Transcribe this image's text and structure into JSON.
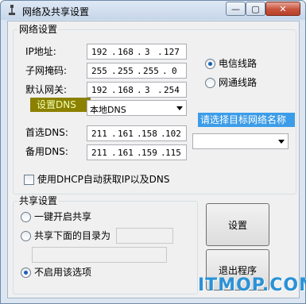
{
  "window": {
    "title": "网络及共享设置",
    "minimize_icon": "minimize-icon",
    "maximize_icon": "maximize-icon",
    "close_icon": "close-icon",
    "min_glyph": "—",
    "max_glyph": "▢",
    "close_glyph": "✕"
  },
  "network": {
    "group_title": "网络设置",
    "ip_label": "IP地址:",
    "mask_label": "子网掩码:",
    "gateway_label": "默认网关:",
    "ip": [
      "192",
      "168",
      "3",
      "127"
    ],
    "mask": [
      "255",
      "255",
      "255",
      "0"
    ],
    "gateway": [
      "192",
      "168",
      "3",
      "254"
    ],
    "isp_options": [
      {
        "label": "电信线路",
        "checked": true
      },
      {
        "label": "网通线路",
        "checked": false
      }
    ],
    "dns_label": "设置DNS",
    "dns_select": "本地DNS",
    "hint_label": "请选择目标网络名称",
    "network_name_select": "",
    "primary_dns_label": "首选DNS:",
    "secondary_dns_label": "备用DNS:",
    "primary_dns": [
      "211",
      "161",
      "158",
      "102"
    ],
    "secondary_dns": [
      "211",
      "161",
      "159",
      "115"
    ],
    "dhcp_checkbox_label": "使用DHCP自动获取IP以及DNS",
    "dhcp_checked": false
  },
  "share": {
    "group_title": "共享设置",
    "options": [
      {
        "label": "一键开启共享",
        "checked": false
      },
      {
        "label": "共享下面的目录为",
        "checked": false
      },
      {
        "label": "不启用该选项",
        "checked": true
      }
    ],
    "share_name_value": "",
    "share_path_value": ""
  },
  "buttons": {
    "settings": "设置",
    "exit": "退出程序"
  },
  "watermark": "ITMOP.COM",
  "colors": {
    "dns_label_bg": "#8b8000",
    "hint_label_bg": "#3c9ce8",
    "watermark": "#2a92d6"
  }
}
